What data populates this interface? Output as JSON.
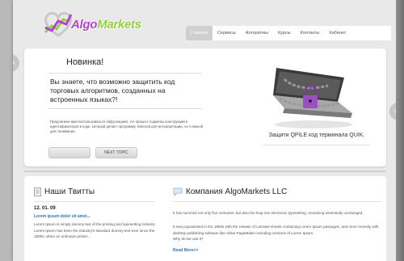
{
  "logo": {
    "name_main": "Algo",
    "name_accent": "Markets"
  },
  "nav": {
    "items": [
      {
        "label": "Главная",
        "active": true
      },
      {
        "label": "Сервисы"
      },
      {
        "label": "Алгоритмы"
      },
      {
        "label": "Курсы"
      },
      {
        "label": "Контакты"
      },
      {
        "label": "Кабинет"
      }
    ]
  },
  "slider": {
    "title": "Новинка!",
    "subtitle": "Вы знаете, что возможно защитить код торговых алгоритмов, созданных на встроенных языках?!",
    "description": "Предлагаем вам воспользоваться обфускацией, это процесс подмены конструкций и идентификаторов в коде, который делает программу тяжелой для интерпретации, но сложной для понимания.",
    "next_button": "NEXT TOPIC",
    "caption": "Защити QPILE код терминала QUIK.",
    "prev_arrow": "‹",
    "next_arrow": "›"
  },
  "tweets": {
    "title": "Наши Твитты",
    "date": "12. 01. 09",
    "link": "Lorem ipsum dolor sit amet...",
    "text": "Lorem Ipsum is simply dummy text of the printing and typesetting industry. Lorem Ipsum has been the industry's standard dummy text ever since the 1500s, when an unknown printer..."
  },
  "company": {
    "title": "Компания AlgoMarkets LLC",
    "p1": "It has survived not only five centuries, but also the leap into electronic typesetting, remaining essentially unchanged.",
    "p2": "It was popularised in the 1960s with the release of Letraset sheets containing Lorem Ipsum passages, and more recently with desktop publishing software like Aldus PageMaker including versions of Lorem Ipsum.",
    "p3": "Why do we use it?",
    "more": "Read More>>"
  },
  "colors": {
    "brand": "#b63fd1",
    "accent": "#8fd23a",
    "link": "#2d74c7"
  },
  "icons": {
    "logo": "heart-chart-icon",
    "tweets": "document-icon",
    "company": "speech-bubble-icon",
    "lock": "padlock-icon"
  }
}
